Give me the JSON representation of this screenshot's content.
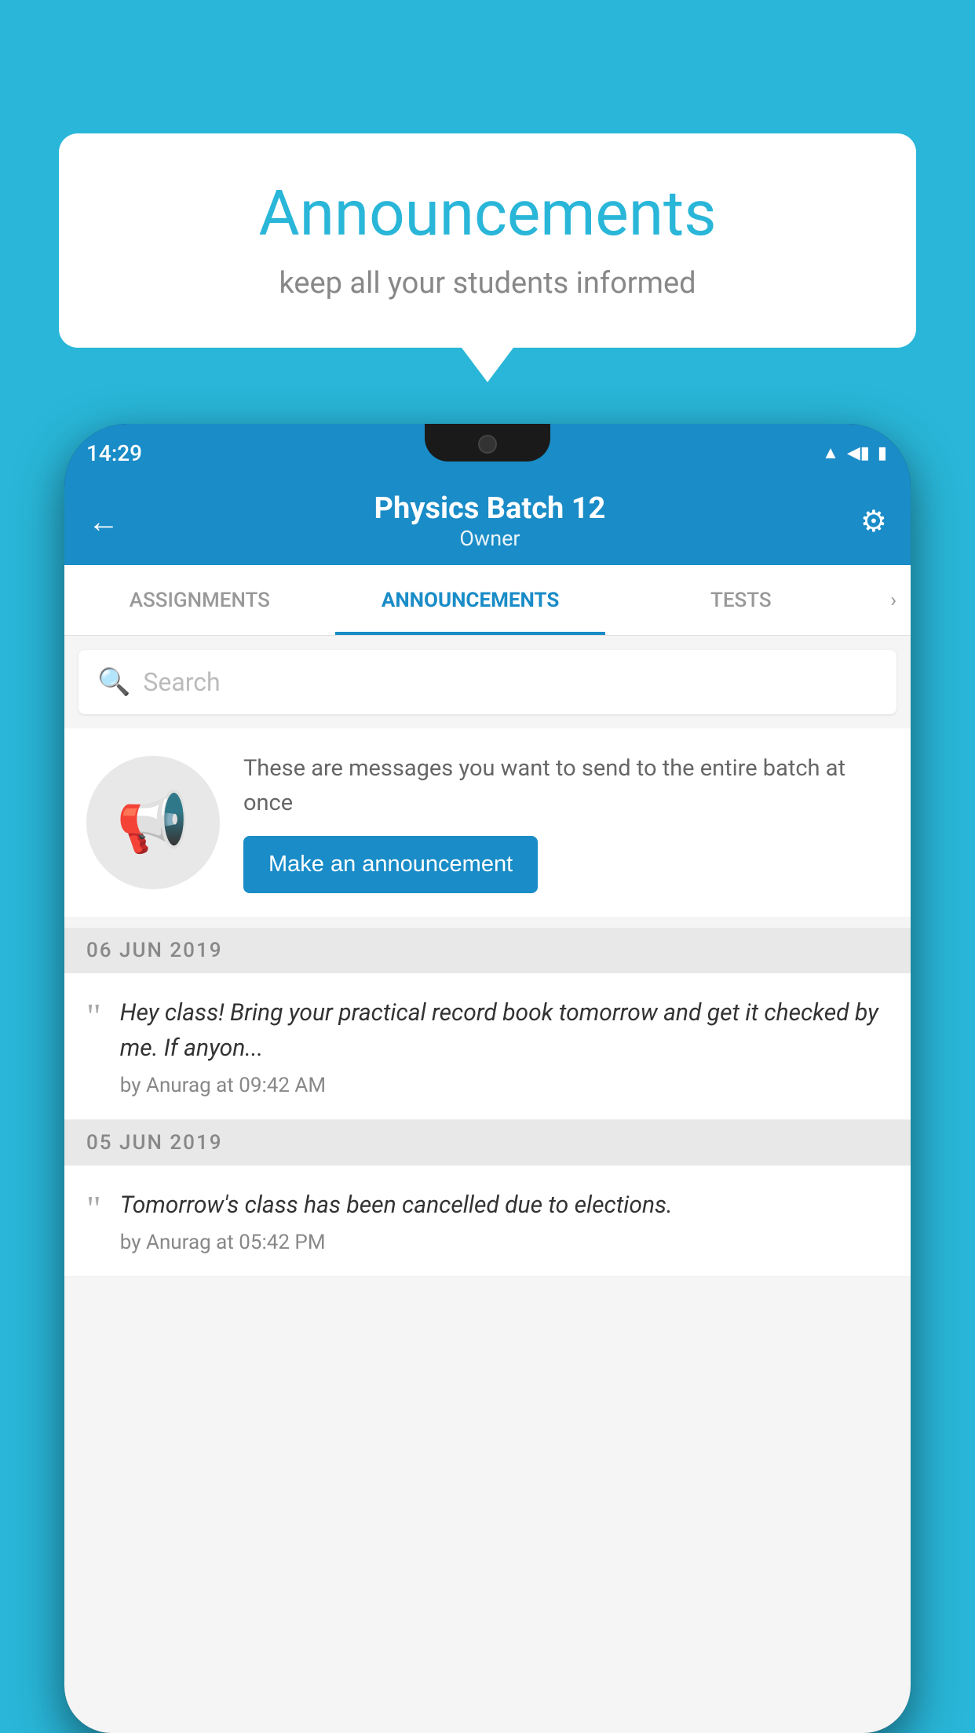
{
  "background_color": "#29b6d8",
  "bubble": {
    "title": "Announcements",
    "subtitle": "keep all your students informed"
  },
  "phone": {
    "status_bar": {
      "time": "14:29"
    },
    "app_bar": {
      "title": "Physics Batch 12",
      "subtitle": "Owner",
      "back_label": "←",
      "settings_label": "⚙"
    },
    "tabs": [
      {
        "label": "ASSIGNMENTS",
        "active": false
      },
      {
        "label": "ANNOUNCEMENTS",
        "active": true
      },
      {
        "label": "TESTS",
        "active": false
      },
      {
        "label": "›",
        "active": false
      }
    ],
    "search": {
      "placeholder": "Search"
    },
    "announcement_prompt": {
      "description": "These are messages you want to send to the entire batch at once",
      "button_label": "Make an announcement"
    },
    "announcements": [
      {
        "date": "06  JUN  2019",
        "message": "Hey class! Bring your practical record book tomorrow and get it checked by me. If anyon...",
        "meta": "by Anurag at 09:42 AM"
      },
      {
        "date": "05  JUN  2019",
        "message": "Tomorrow's class has been cancelled due to elections.",
        "meta": "by Anurag at 05:42 PM"
      }
    ]
  }
}
